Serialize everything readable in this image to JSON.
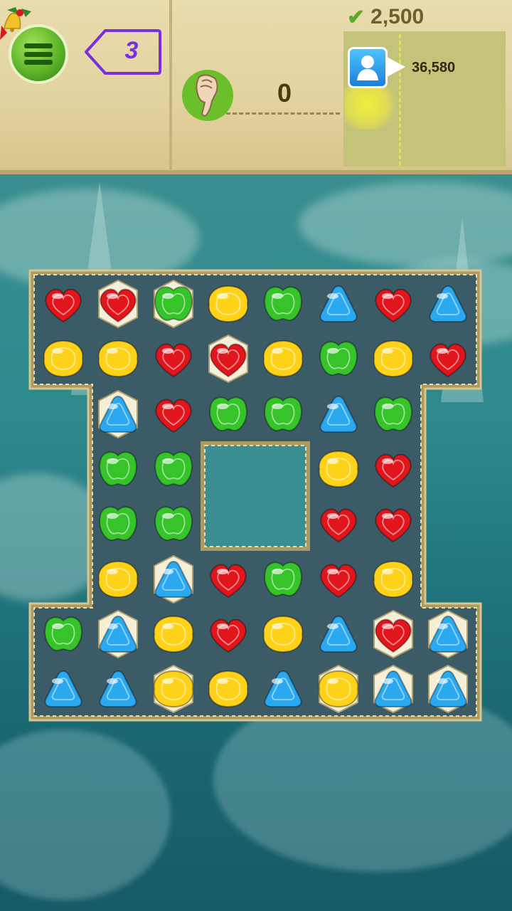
{
  "header": {
    "moves_left": "3",
    "score": "0",
    "target_score": "2,500",
    "friend_score": "36,580"
  },
  "icons": {
    "menu": "menu-icon",
    "bells": "christmas-bells-icon",
    "hand": "pointing-hand-icon",
    "check": "checkmark-icon",
    "avatar": "friend-avatar-icon"
  },
  "colors": {
    "red": "#e0161c",
    "yellow": "#ffd21a",
    "green": "#36c42a",
    "blue": "#2aa8f0",
    "moves_accent": "#7a2ee0"
  },
  "board": {
    "rows": [
      [
        "R",
        "R*",
        "G*",
        "Y",
        "G",
        "B",
        "R",
        "B"
      ],
      [
        "Y",
        "Y",
        "R",
        "R*",
        "Y",
        "G",
        "Y",
        "R"
      ],
      [
        "",
        "B*",
        "R",
        "G",
        "G",
        "B",
        "G",
        ""
      ],
      [
        "",
        "G",
        "G",
        "",
        "",
        "Y",
        "R",
        ""
      ],
      [
        "",
        "G",
        "G",
        "",
        "",
        "R",
        "R",
        ""
      ],
      [
        "",
        "Y",
        "B*",
        "R",
        "G",
        "R",
        "Y",
        ""
      ],
      [
        "G",
        "B*",
        "Y",
        "R",
        "Y",
        "B",
        "R*",
        "B*"
      ],
      [
        "B",
        "B",
        "Y*",
        "Y",
        "B",
        "Y*",
        "B*",
        "B*"
      ]
    ]
  }
}
